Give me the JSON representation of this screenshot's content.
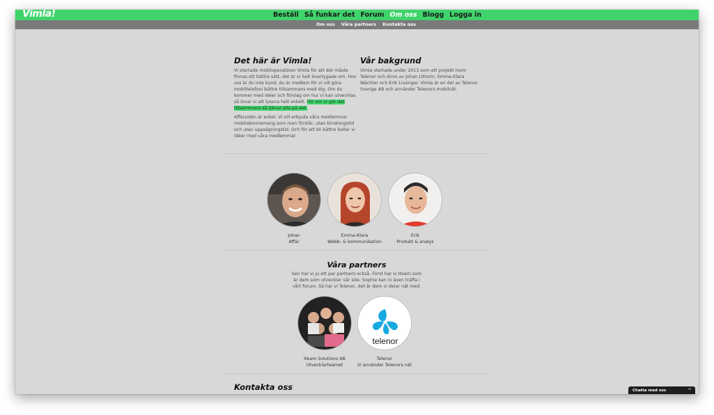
{
  "brand": {
    "logo": "Vimla!"
  },
  "main_nav": [
    {
      "label": "Beställ",
      "active": false
    },
    {
      "label": "Så funkar det",
      "active": false
    },
    {
      "label": "Forum",
      "active": false
    },
    {
      "label": "Om oss",
      "active": true
    },
    {
      "label": "Blogg",
      "active": false
    },
    {
      "label": "Logga in",
      "active": false
    }
  ],
  "sub_nav": [
    "Om oss",
    "Våra partners",
    "Kontakta oss"
  ],
  "about": {
    "title": "Det här är Vimla!",
    "p1_text": "Vi startade mobiloperatören Vimla för att det måste finnas ett bättre sätt, det är vi helt övertygade om. Hos oss är du inte kund, du är medlem för vi vill göra mobiltelefoni bättre tillsammans med dig. Om du kommer med idéer och förslag om hur vi kan utvecklas så lovar vi att lyssna helt enkelt.",
    "p1_highlight": "För om vi gör det tillsammans så tjänar alla på det.",
    "p2": "Affärsidén är enkel. Vi vill erbjuda våra medlemmar mobilabonnemang som man förstår, utan bindningstid och utan uppsägningstid. Och för att bli bättre bollar vi idéer med våra medlemmar."
  },
  "background": {
    "title": "Vår bakgrund",
    "text": "Vimla startade under 2013 som ett projekt inom Telenor och drivs av Johan Littorin, Emma-Klara Wächter och Erik Lissinger. Vimla är en del av Telenor Sverige AB och använder Telenors mobilnät."
  },
  "team": [
    {
      "name": "Johan",
      "role": "Affär"
    },
    {
      "name": "Emma-Klara",
      "role": "Webb- & kommunikation"
    },
    {
      "name": "Erik",
      "role": "Produkt & analys"
    }
  ],
  "partners": {
    "title": "Våra partners",
    "text": "Sen har vi ju ett par partners också. Först har vi Iteam som är dem som utvecklar vår site. Sophie kan ni även träffa i vårt forum. Så har vi Telenor, det är dem vi delar nät med.",
    "items": [
      {
        "name": "Iteam Solutions AB",
        "role": "Utvecklarteamet"
      },
      {
        "name": "Telenor",
        "role": "Vi använder Telenors nät",
        "logo_text": "telenor"
      }
    ]
  },
  "contact": {
    "title": "Kontakta oss"
  },
  "chat": {
    "label": "Chatta med oss",
    "caret": "^"
  },
  "colors": {
    "brand_green": "#3fd46b",
    "subnav_gray": "#7a7a7a",
    "page_bg": "#d8d8d8",
    "telenor_blue": "#19a9e1"
  }
}
